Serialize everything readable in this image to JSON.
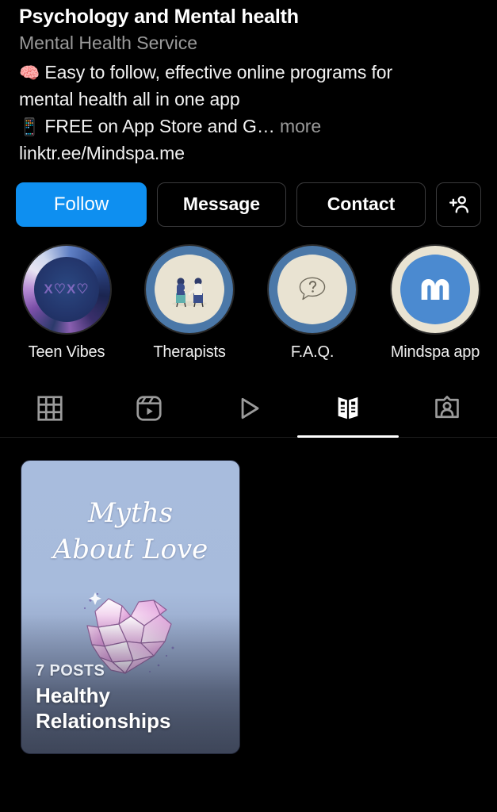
{
  "profile": {
    "title": "Psychology and Mental health",
    "category": "Mental Health Service",
    "bio_line1_emoji": "🧠",
    "bio_line1": "Easy to follow, effective online programs for",
    "bio_line2": "mental health all in one app",
    "bio_line3_emoji": "📱",
    "bio_line3": "FREE on App Store and G…",
    "more_label": "more",
    "link": "linktr.ee/Mindspa.me"
  },
  "actions": {
    "follow_label": "Follow",
    "message_label": "Message",
    "contact_label": "Contact",
    "add_person_icon": "add-person-icon",
    "follow_color": "#0e8ff0"
  },
  "highlights": [
    {
      "label": "Teen Vibes",
      "cover": "xoxo-hearts",
      "xoxo": "X♡X♡"
    },
    {
      "label": "Therapists",
      "cover": "two-people-talking"
    },
    {
      "label": "F.A.Q.",
      "cover": "question-speech-bubble"
    },
    {
      "label": "Mindspa app",
      "cover": "mindspa-m-logo",
      "logo": "m"
    }
  ],
  "tabs": [
    {
      "name": "grid",
      "icon": "grid-icon",
      "active": false
    },
    {
      "name": "reels",
      "icon": "reels-icon",
      "active": false
    },
    {
      "name": "video",
      "icon": "play-icon",
      "active": false
    },
    {
      "name": "guides",
      "icon": "guides-book-icon",
      "active": true
    },
    {
      "name": "tagged",
      "icon": "tagged-person-icon",
      "active": false
    }
  ],
  "guides": [
    {
      "cover_title_line1": "Myths",
      "cover_title_line2": "About Love",
      "posts_count": "7 POSTS",
      "name_line1": "Healthy",
      "name_line2": "Relationships",
      "artwork": "crystal-heart"
    }
  ]
}
